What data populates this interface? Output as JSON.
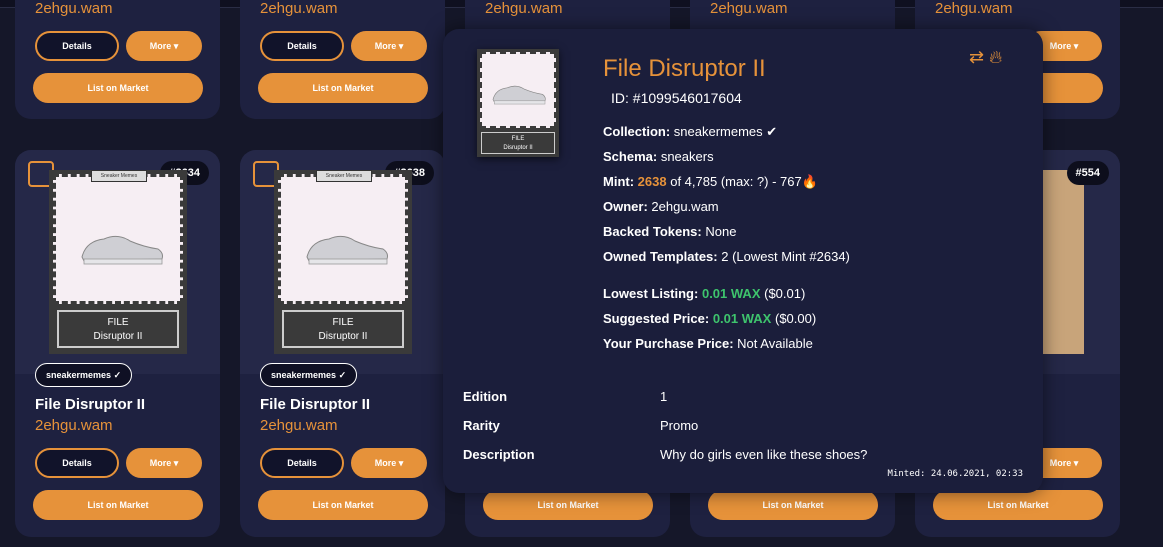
{
  "cards_top": [
    {
      "owner": "2ehgu.wam",
      "details": "Details",
      "more": "More",
      "list": "List on Market"
    },
    {
      "owner": "2ehgu.wam",
      "details": "Details",
      "more": "More",
      "list": "List on Market"
    },
    {
      "owner": "2ehgu.wam"
    },
    {
      "owner": "2ehgu.wam"
    },
    {
      "owner": "2ehgu.wam",
      "more": "More"
    }
  ],
  "cards_bottom": [
    {
      "mint": "#2634",
      "collection": "sneakermemes",
      "title": "File Disruptor II",
      "owner": "2ehgu.wam",
      "details": "Details",
      "more": "More",
      "list": "List on Market"
    },
    {
      "mint": "#2638",
      "collection": "sneakermemes",
      "title": "File Disruptor II",
      "owner": "2ehgu.wam",
      "details": "Details",
      "more": "More",
      "list": "List on Market"
    },
    {
      "list": "List on Market"
    },
    {
      "list": "List on Market"
    },
    {
      "mint": "#554",
      "more": "More",
      "list": "List on Market"
    }
  ],
  "nft_art": {
    "tag": "Sneaker Memes",
    "line1": "FILE",
    "line2": "Disruptor II"
  },
  "popup": {
    "title": "File Disruptor II",
    "id": "ID: #1099546017604",
    "collection_label": "Collection:",
    "collection": "sneakermemes",
    "schema_label": "Schema:",
    "schema": "sneakers",
    "mint_label": "Mint:",
    "mint_num": "2638",
    "mint_rest": "of 4,785 (max: ?) - 767🔥",
    "owner_label": "Owner:",
    "owner": "2ehgu.wam",
    "backed_label": "Backed Tokens:",
    "backed": "None",
    "owned_label": "Owned Templates:",
    "owned": "2 (Lowest Mint #2634)",
    "lowest_label": "Lowest Listing:",
    "lowest_wax": "0.01 WAX",
    "lowest_usd": "($0.01)",
    "suggested_label": "Suggested Price:",
    "suggested_wax": "0.01 WAX",
    "suggested_usd": "($0.00)",
    "purchase_label": "Your Purchase Price:",
    "purchase": "Not Available",
    "attributes": [
      {
        "k": "Edition",
        "v": "1"
      },
      {
        "k": "Rarity",
        "v": "Promo"
      },
      {
        "k": "Description",
        "v": "Why do girls even like these shoes?"
      }
    ],
    "minted": "Minted: 24.06.2021, 02:33"
  },
  "colors": {
    "accent": "#e6923a",
    "bg": "#151729",
    "card": "#1e2140",
    "green": "#3ec46d"
  }
}
